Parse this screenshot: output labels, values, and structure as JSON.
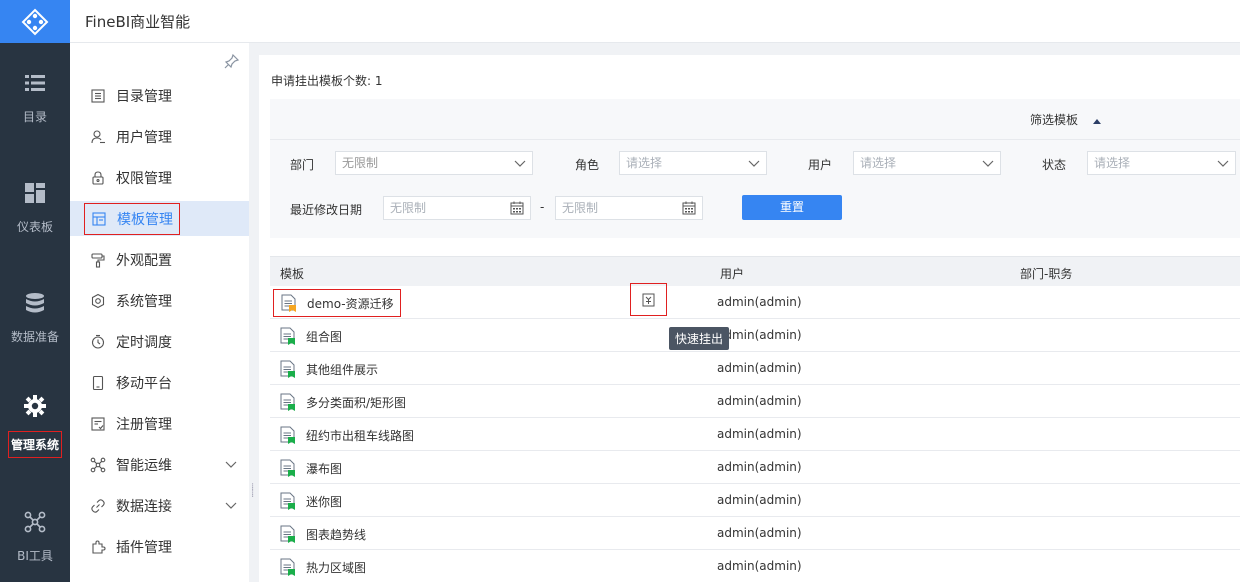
{
  "app": {
    "title": "FineBI商业智能"
  },
  "rail": {
    "items": [
      {
        "label": "目录",
        "icon": "list-icon"
      },
      {
        "label": "仪表板",
        "icon": "dashboard-icon"
      },
      {
        "label": "数据准备",
        "icon": "database-icon"
      },
      {
        "label": "管理系统",
        "icon": "gear-icon",
        "active": true
      },
      {
        "label": "BI工具",
        "icon": "tools-icon"
      }
    ]
  },
  "menu": {
    "items": [
      {
        "label": "目录管理",
        "icon": "directory-icon"
      },
      {
        "label": "用户管理",
        "icon": "user-icon"
      },
      {
        "label": "权限管理",
        "icon": "lock-icon"
      },
      {
        "label": "模板管理",
        "icon": "template-icon",
        "active": true
      },
      {
        "label": "外观配置",
        "icon": "brush-icon"
      },
      {
        "label": "系统管理",
        "icon": "settings-icon"
      },
      {
        "label": "定时调度",
        "icon": "clock-icon"
      },
      {
        "label": "移动平台",
        "icon": "mobile-icon"
      },
      {
        "label": "注册管理",
        "icon": "register-icon"
      },
      {
        "label": "智能运维",
        "icon": "ops-icon",
        "expandable": true
      },
      {
        "label": "数据连接",
        "icon": "link-icon",
        "expandable": true
      },
      {
        "label": "插件管理",
        "icon": "plugin-icon"
      }
    ]
  },
  "content": {
    "count_text": "申请挂出模板个数: 1",
    "filter": {
      "toggle_label": "筛选模板",
      "department_label": "部门",
      "department_value": "无限制",
      "role_label": "角色",
      "role_placeholder": "请选择",
      "user_label": "用户",
      "user_placeholder": "请选择",
      "status_label": "状态",
      "status_placeholder": "请选择",
      "date_label": "最近修改日期",
      "date_from": "无限制",
      "date_separator": "-",
      "date_to": "无限制",
      "reset_label": "重置"
    },
    "table": {
      "columns": [
        "模板",
        "用户",
        "部门-职务"
      ],
      "rows": [
        {
          "name": "demo-资源迁移",
          "user": "admin(admin)",
          "dept": "",
          "icon_color": "#f5a623"
        },
        {
          "name": "组合图",
          "user": "admin(admin)",
          "dept": "",
          "icon_color": "#1aae4a"
        },
        {
          "name": "其他组件展示",
          "user": "admin(admin)",
          "dept": "",
          "icon_color": "#1aae4a"
        },
        {
          "name": "多分类面积/矩形图",
          "user": "admin(admin)",
          "dept": "",
          "icon_color": "#1aae4a"
        },
        {
          "name": "纽约市出租车线路图",
          "user": "admin(admin)",
          "dept": "",
          "icon_color": "#1aae4a"
        },
        {
          "name": "瀑布图",
          "user": "admin(admin)",
          "dept": "",
          "icon_color": "#1aae4a"
        },
        {
          "name": "迷你图",
          "user": "admin(admin)",
          "dept": "",
          "icon_color": "#1aae4a"
        },
        {
          "name": "图表趋势线",
          "user": "admin(admin)",
          "dept": "",
          "icon_color": "#1aae4a"
        },
        {
          "name": "热力区域图",
          "user": "admin(admin)",
          "dept": "",
          "icon_color": "#1aae4a"
        }
      ]
    },
    "tooltip": "快速挂出"
  },
  "colors": {
    "accent": "#3685f2",
    "rail_bg": "#283441",
    "highlight_border": "#e02020"
  }
}
